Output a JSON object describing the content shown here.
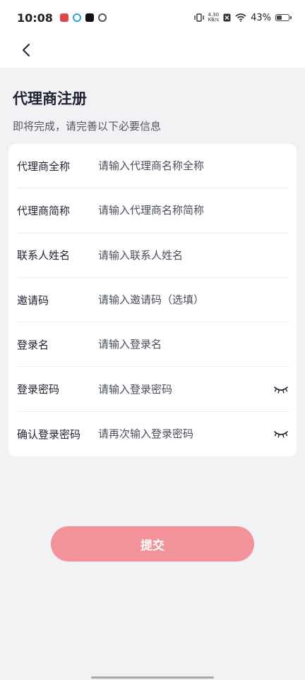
{
  "status_bar": {
    "time": "10:08",
    "net_speed_value": "4.30",
    "net_speed_unit": "KB/s",
    "battery_text": "43%",
    "battery_level": 0.43
  },
  "nav": {
    "back_icon": "chevron-left-icon"
  },
  "header": {
    "title": "代理商注册",
    "subtitle": "即将完成，请完善以下必要信息"
  },
  "form": {
    "fields": [
      {
        "label": "代理商全称",
        "placeholder": "请输入代理商名称全称",
        "value": "",
        "has_eye": false
      },
      {
        "label": "代理商简称",
        "placeholder": "请输入代理商名称简称",
        "value": "",
        "has_eye": false
      },
      {
        "label": "联系人姓名",
        "placeholder": "请输入联系人姓名",
        "value": "",
        "has_eye": false
      },
      {
        "label": "邀请码",
        "placeholder": "请输入邀请码（选填）",
        "value": "",
        "has_eye": false
      },
      {
        "label": "登录名",
        "placeholder": "请输入登录名",
        "value": "",
        "has_eye": false
      },
      {
        "label": "登录密码",
        "placeholder": "请输入登录密码",
        "value": "",
        "has_eye": true
      },
      {
        "label": "确认登录密码",
        "placeholder": "请再次输入登录密码",
        "value": "",
        "has_eye": true
      }
    ]
  },
  "submit": {
    "label": "提交"
  },
  "colors": {
    "accent": "#f39298",
    "background": "#f2f2f4",
    "card": "#ffffff"
  }
}
